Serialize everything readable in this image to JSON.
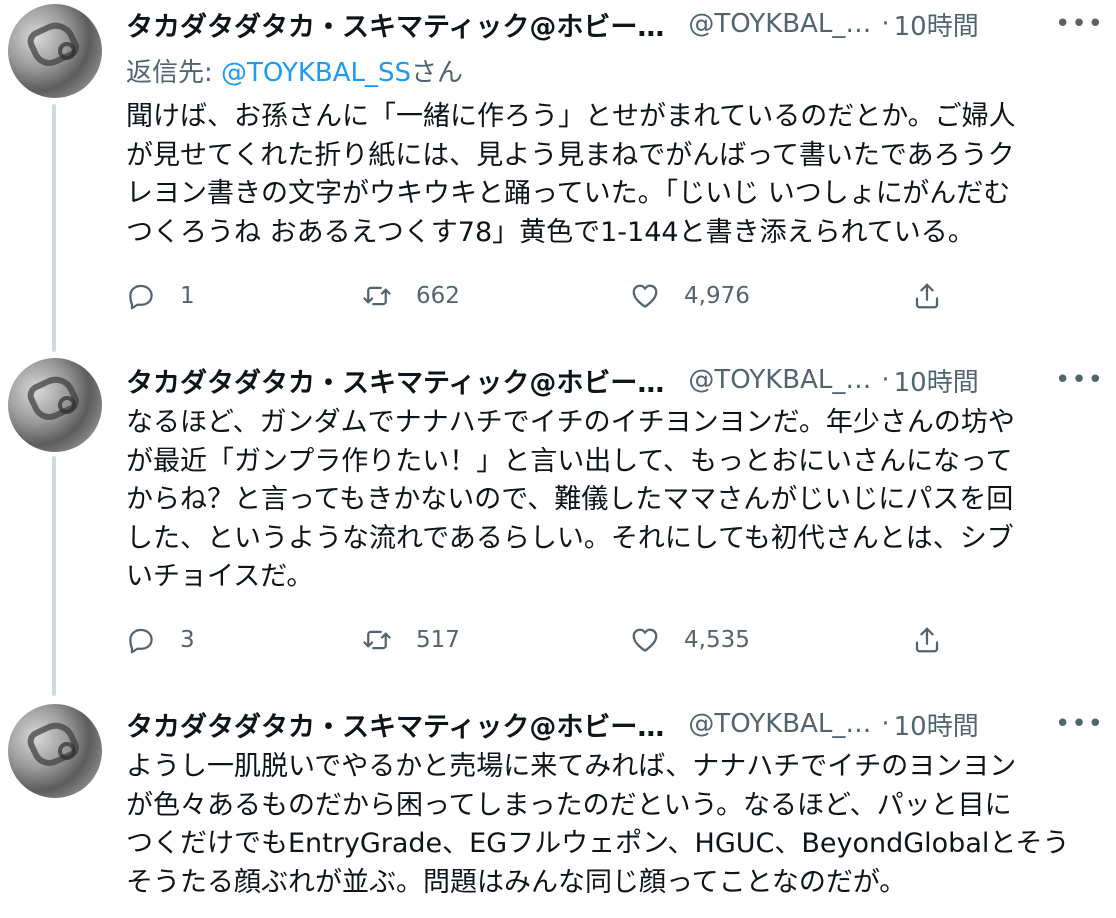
{
  "tweets": [
    {
      "name": "タカダタダタカ・スキマティック@ホビー…",
      "handle": "@TOYKBAL_…",
      "time": "10時間",
      "reply_label": "返信先: ",
      "reply_handle": "@TOYKBAL_SS",
      "reply_suffix": "さん",
      "lines": [
        "聞けば、お孫さんに「一緒に作ろう」とせがまれているのだとか。ご婦人",
        "が見せてくれた折り紙には、見よう見まねでがんばって書いたであろうク",
        "レヨン書きの文字がウキウキと踊っていた。「じいじ いつしょにがんだむ",
        "つくろうね おあるえつくす78」黄色で1-144と書き添えられている。"
      ],
      "replies": "1",
      "retweets": "662",
      "likes": "4,976"
    },
    {
      "name": "タカダタダタカ・スキマティック@ホビー…",
      "handle": "@TOYKBAL_…",
      "time": "10時間",
      "lines": [
        "なるほど、ガンダムでナナハチでイチのイチヨンヨンだ。年少さんの坊や",
        "が最近「ガンプラ作りたい！」と言い出して、もっとおにいさんになって",
        "からね？と言ってもきかないので、難儀したママさんがじいじにパスを回",
        "した、というような流れであるらしい。それにしても初代さんとは、シブ",
        "いチョイスだ。"
      ],
      "replies": "3",
      "retweets": "517",
      "likes": "4,535"
    },
    {
      "name": "タカダタダタカ・スキマティック@ホビー…",
      "handle": "@TOYKBAL_…",
      "time": "10時間",
      "lines": [
        "ようし一肌脱いでやるかと売場に来てみれば、ナナハチでイチのヨンヨン",
        "が色々あるものだから困ってしまったのだという。なるほど、パッと目に",
        "つくだけでもEntryGrade、EGフルウェポン、HGUC、BeyondGlobalとそう",
        "そうたる顔ぶれが並ぶ。問題はみんな同じ顔ってことなのだが。"
      ]
    }
  ],
  "colors": {
    "link": "#1d9bf0",
    "secondary_text": "#536471",
    "primary_text": "#0f1419",
    "thread_line": "#cfd9de"
  },
  "icons": [
    "reply-icon",
    "retweet-icon",
    "like-icon",
    "share-icon",
    "more-icon"
  ]
}
